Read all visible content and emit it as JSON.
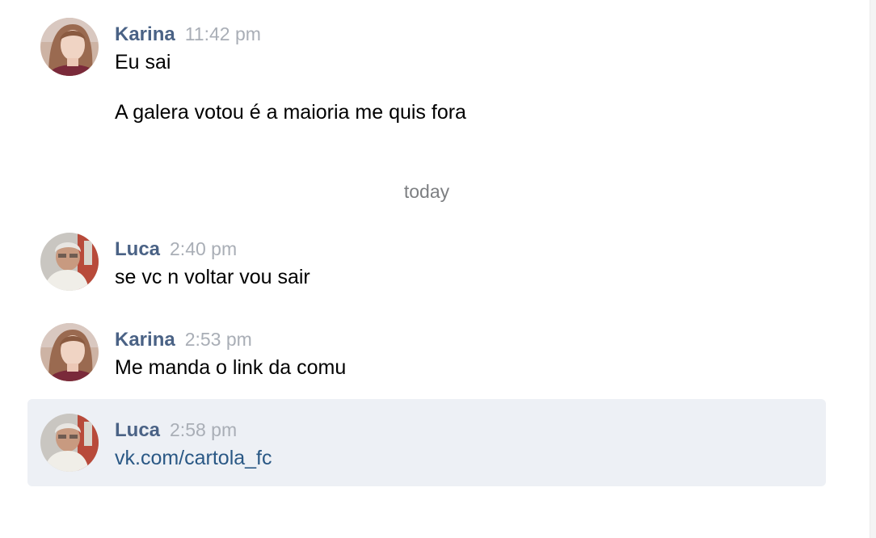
{
  "messages": [
    {
      "author": "Karina",
      "time": "11:42 pm",
      "avatar_icon": "karina-avatar",
      "lines": [
        "Eu sai",
        "A galera votou é a maioria me quis fora"
      ]
    },
    {
      "author": "Luca",
      "time": "2:40 pm",
      "avatar_icon": "luca-avatar",
      "lines": [
        "se vc n voltar vou sair"
      ]
    },
    {
      "author": "Karina",
      "time": "2:53 pm",
      "avatar_icon": "karina-avatar",
      "lines": [
        "Me manda o link da comu"
      ]
    },
    {
      "author": "Luca",
      "time": "2:58 pm",
      "avatar_icon": "luca-avatar",
      "lines": [
        "vk.com/cartola_fc"
      ]
    }
  ],
  "date_separator": "today",
  "colors": {
    "author": "#4a6285",
    "time": "#a9aeb6",
    "link": "#2a5885",
    "highlight": "#edf0f5"
  }
}
